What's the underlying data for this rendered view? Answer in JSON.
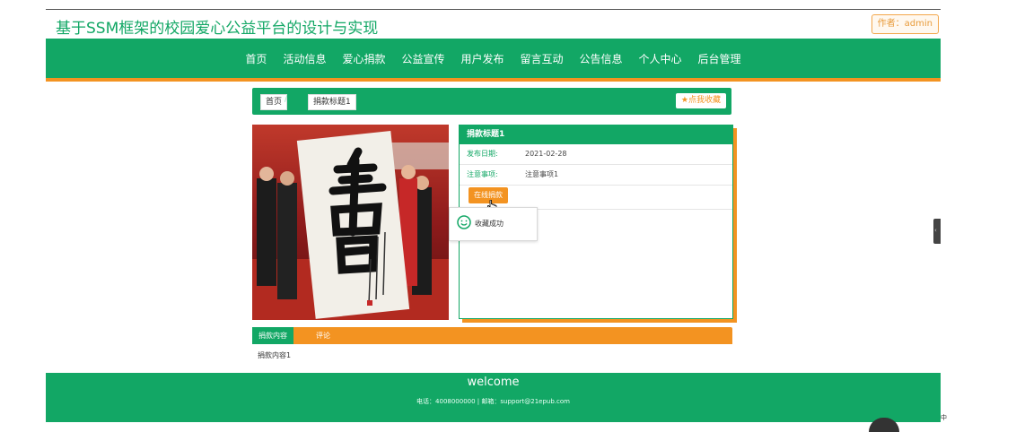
{
  "header": {
    "site_title": "基于SSM框架的校园爱心公益平台的设计与实现",
    "author_badge": "作者：admin"
  },
  "nav": {
    "items": [
      {
        "label": "首页"
      },
      {
        "label": "活动信息"
      },
      {
        "label": "爱心捐款"
      },
      {
        "label": "公益宣传"
      },
      {
        "label": "用户发布"
      },
      {
        "label": "留言互动"
      },
      {
        "label": "公告信息"
      },
      {
        "label": "个人中心"
      },
      {
        "label": "后台管理"
      }
    ]
  },
  "breadcrumb": {
    "home": "首页",
    "separator": "/",
    "current": "捐款标题1",
    "favorite_label": "★点我收藏"
  },
  "detail": {
    "title": "捐款标题1",
    "rows": [
      {
        "label": "发布日期:",
        "value": "2021-02-28"
      },
      {
        "label": "注意事项:",
        "value": "注意事项1"
      }
    ],
    "donate_label": "在线捐款"
  },
  "toast": {
    "icon": "smile-icon",
    "message": "收藏成功"
  },
  "tabs": {
    "items": [
      {
        "label": "捐款内容",
        "active": true
      },
      {
        "label": "评论",
        "active": false
      }
    ],
    "content": "捐款内容1"
  },
  "footer": {
    "welcome": "welcome",
    "contact": "电话：4008000000 | 邮箱：support@21epub.com"
  },
  "misc": {
    "side_tab_glyph": "‹",
    "corner_char": "中"
  },
  "colors": {
    "primary_green": "#12a765",
    "accent_orange": "#f39321"
  }
}
